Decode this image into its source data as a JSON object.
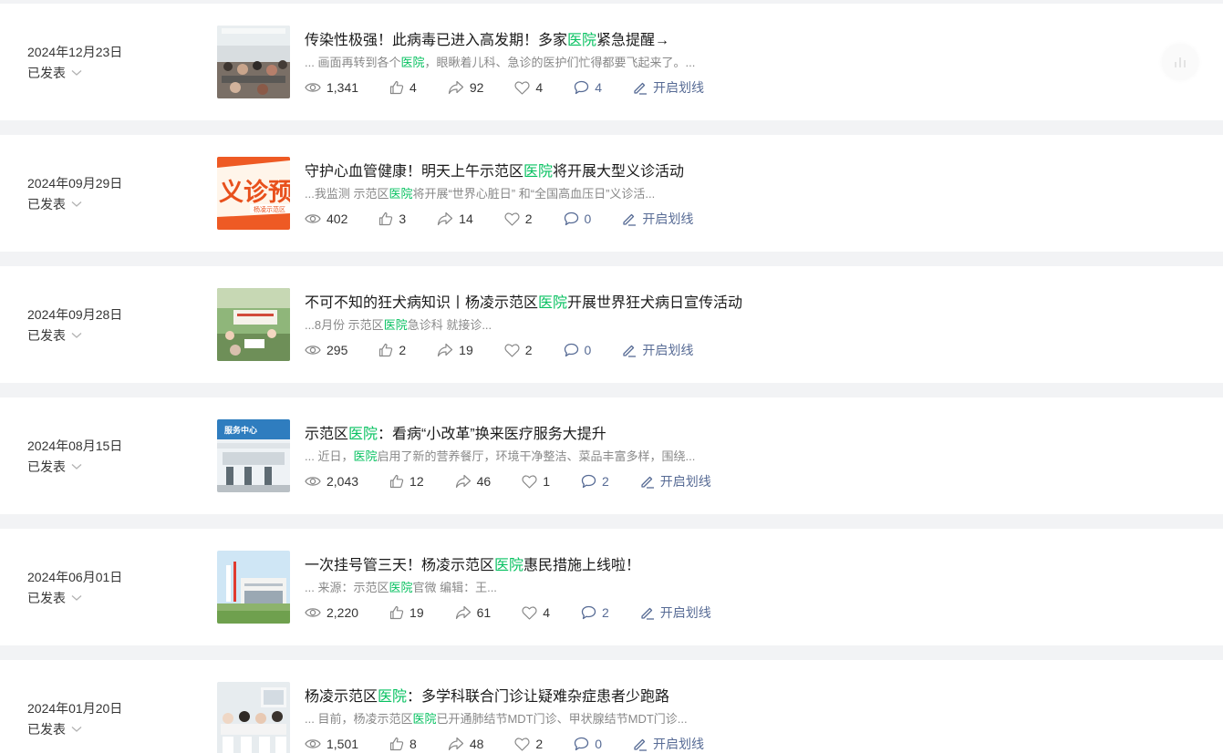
{
  "articles": [
    {
      "date": "2024年12月23日",
      "status": "已发表",
      "title_pre": "传染性极强！此病毒已进入高发期！多家",
      "title_hl": "医院",
      "title_post": "紧急提醒→",
      "digest_pre": "... 画面再转到各个",
      "digest_hl": "医院",
      "digest_post": "，眼瞅着儿科、急诊的医护们忙得都要飞起来了。...",
      "views": "1,341",
      "likes": "4",
      "shares": "92",
      "favs": "4",
      "comments": "4",
      "underline": "开启划线"
    },
    {
      "date": "2024年09月29日",
      "status": "已发表",
      "title_pre": "守护心血管健康！明天上午示范区",
      "title_hl": "医院",
      "title_post": "将开展大型义诊活动",
      "digest_pre": "...我监测 示范区",
      "digest_hl": "医院",
      "digest_post": "将开展“世界心脏日” 和“全国高血压日”义诊活...",
      "views": "402",
      "likes": "3",
      "shares": "14",
      "favs": "2",
      "comments": "0",
      "underline": "开启划线",
      "thumb_text": "义诊预",
      "thumb_sub": "杨凌示范区"
    },
    {
      "date": "2024年09月28日",
      "status": "已发表",
      "title_pre": "不可不知的狂犬病知识丨杨凌示范区",
      "title_hl": "医院",
      "title_post": "开展世界狂犬病日宣传活动",
      "digest_pre": "...8月份 示范区",
      "digest_hl": "医院",
      "digest_post": "急诊科 就接诊...",
      "views": "295",
      "likes": "2",
      "shares": "19",
      "favs": "2",
      "comments": "0",
      "underline": "开启划线"
    },
    {
      "date": "2024年08月15日",
      "status": "已发表",
      "title_pre": "示范区",
      "title_hl": "医院",
      "title_post": "：看病“小改革”换来医疗服务大提升",
      "digest_pre": "... 近日，",
      "digest_hl": "医院",
      "digest_post": "启用了新的营养餐厅，环境干净整洁、菜品丰富多样，围绕...",
      "views": "2,043",
      "likes": "12",
      "shares": "46",
      "favs": "1",
      "comments": "2",
      "underline": "开启划线",
      "thumb_text": "服务中心"
    },
    {
      "date": "2024年06月01日",
      "status": "已发表",
      "title_pre": "一次挂号管三天！杨凌示范区",
      "title_hl": "医院",
      "title_post": "惠民措施上线啦！",
      "digest_pre": "... 来源：示范区",
      "digest_hl": "医院",
      "digest_post": "官微 编辑：王...",
      "views": "2,220",
      "likes": "19",
      "shares": "61",
      "favs": "4",
      "comments": "2",
      "underline": "开启划线"
    },
    {
      "date": "2024年01月20日",
      "status": "已发表",
      "title_pre": "杨凌示范区",
      "title_hl": "医院",
      "title_post": "：多学科联合门诊让疑难杂症患者少跑路",
      "digest_pre": "... 目前，杨凌示范区",
      "digest_hl": "医院",
      "digest_post": "已开通肺结节MDT门诊、甲状腺结节MDT门诊...",
      "views": "1,501",
      "likes": "8",
      "shares": "48",
      "favs": "2",
      "comments": "0",
      "underline": "开启划线"
    }
  ],
  "icons": {
    "status": "chevron-down-icon",
    "views": "eye-icon",
    "likes": "thumbs-up-icon",
    "shares": "share-arrow-icon",
    "favs": "heart-icon",
    "comments": "comment-bubble-icon",
    "underline": "pen-icon",
    "chart": "bar-chart-icon"
  },
  "colors": {
    "highlight": "#07c160",
    "link": "#576b95",
    "background": "#f2f3f5",
    "card": "#ffffff"
  }
}
